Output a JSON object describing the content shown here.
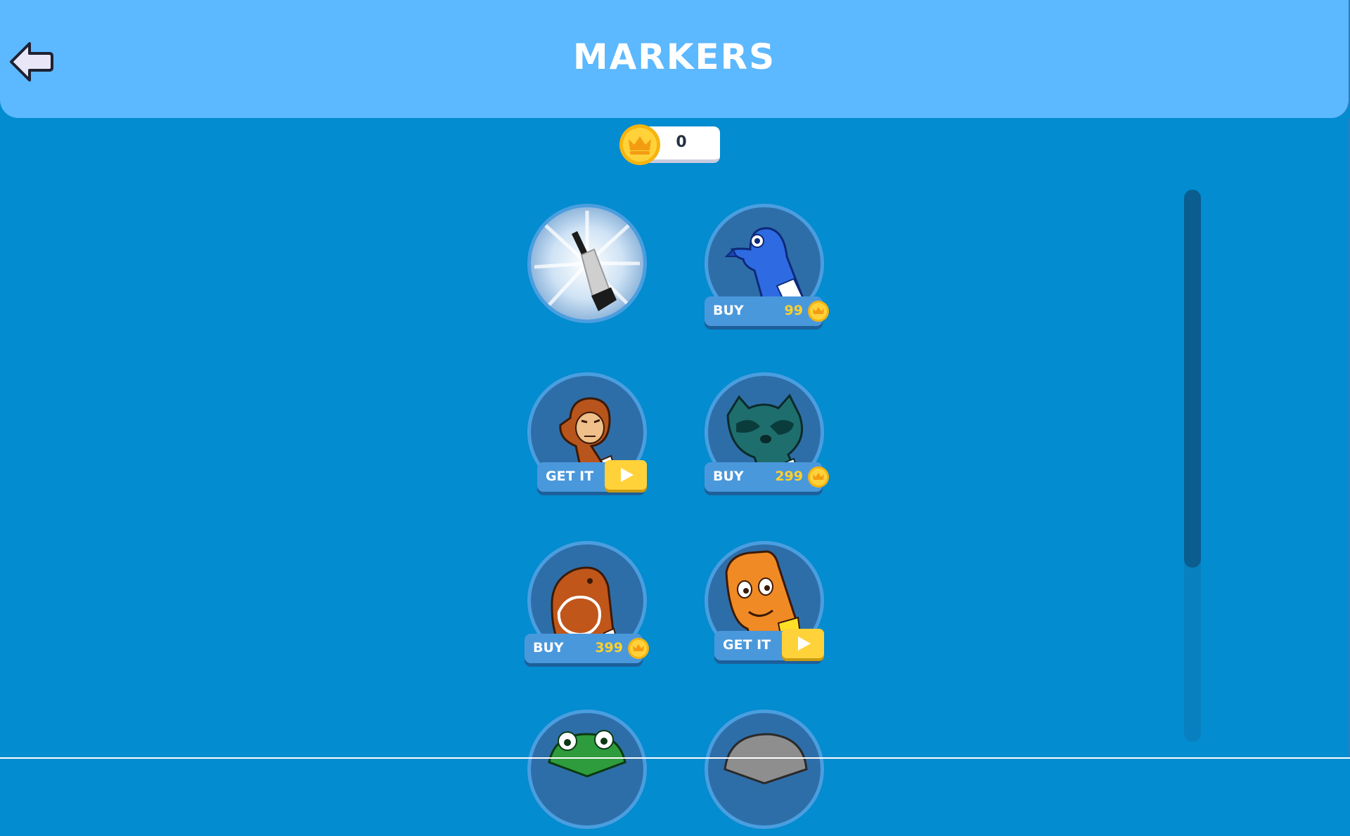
{
  "header": {
    "title": "MARKERS"
  },
  "coins": {
    "balance": "0"
  },
  "colors": {
    "header": "#5cb8ff",
    "background": "#038ccf",
    "price": "#ffd12e",
    "play": "#ffd23a"
  },
  "markers": [
    {
      "name": "classic-marker",
      "action": "",
      "price": ""
    },
    {
      "name": "pigeon-marker",
      "action": "BUY",
      "price": "99"
    },
    {
      "name": "monkey-marker",
      "action": "GET IT",
      "price": ""
    },
    {
      "name": "raccoon-marker",
      "action": "BUY",
      "price": "299"
    },
    {
      "name": "capybara-marker",
      "action": "BUY",
      "price": "399"
    },
    {
      "name": "face-marker",
      "action": "GET IT",
      "price": ""
    },
    {
      "name": "frog-marker",
      "action": "",
      "price": ""
    },
    {
      "name": "seal-marker",
      "action": "",
      "price": ""
    }
  ]
}
